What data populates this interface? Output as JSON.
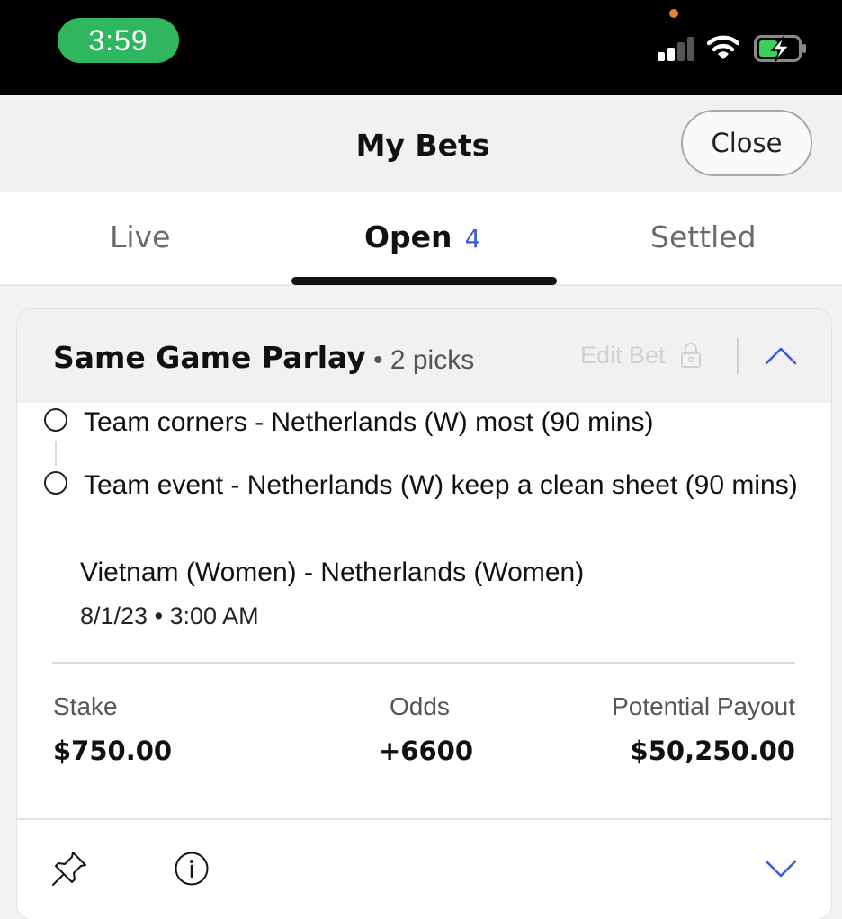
{
  "status_bar": {
    "time": "3:59",
    "icons": [
      "cellular-signal-icon",
      "wifi-icon",
      "battery-charging-icon"
    ],
    "time_pill_color": "#2fb760"
  },
  "header": {
    "title": "My Bets",
    "close_label": "Close"
  },
  "tabs": [
    {
      "label": "Live"
    },
    {
      "label": "Open",
      "count": "4",
      "selected": true
    },
    {
      "label": "Settled"
    }
  ],
  "bet": {
    "title": "Same Game Parlay",
    "subtitle": "• 2 picks",
    "edit_label": "Edit Bet",
    "picks": [
      {
        "text": "Team corners - Netherlands (W) most (90 mins)"
      },
      {
        "text": "Team event - Netherlands (W) keep a clean sheet (90 mins)"
      }
    ],
    "event": {
      "name": "Vietnam (Women) - Netherlands (Women)",
      "date": "8/1/23 • 3:00 AM"
    },
    "stats": {
      "stake_label": "Stake",
      "stake_value": "$750.00",
      "odds_label": "Odds",
      "odds_value": "+6600",
      "payout_label": "Potential Payout",
      "payout_value": "$50,250.00"
    },
    "footer_icons": [
      "pin-icon",
      "info-icon",
      "chevron-down-icon"
    ]
  },
  "colors": {
    "accent": "#3b5bd9",
    "header_bg": "#f1f1f2",
    "disabled_text": "#d2d2d2"
  }
}
